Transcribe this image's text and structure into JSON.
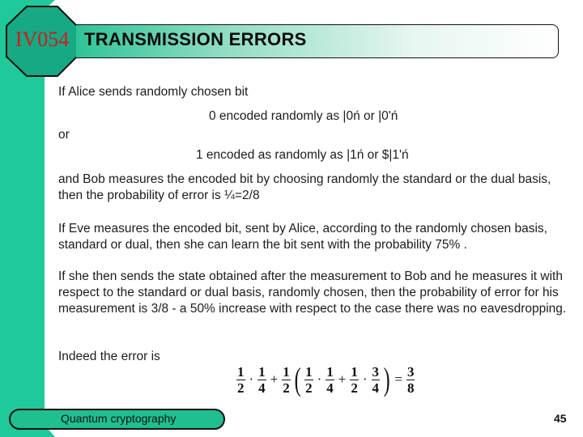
{
  "slide": {
    "course_code": "IV054",
    "title": "TRANSMISSION ERRORS",
    "colors": {
      "accent_teal": "#1fc99a",
      "octagon_fill": "#17a884",
      "course_code_red": "#c8201f"
    }
  },
  "body": {
    "p1": "If Alice sends randomly chosen bit",
    "encoding_zero": "0 encoded randomly as |0ń or |0'ń",
    "or": "or",
    "encoding_one": "1 encoded as randomly as |1ń or $|1'ń",
    "p2": "and Bob measures the encoded bit by choosing randomly the standard or the dual basis, then the probability of error is ¼=2/8",
    "p3": "If Eve measures the encoded bit, sent by Alice, according to the randomly chosen basis, standard or dual, then she can learn the bit sent with the probability 75% .",
    "p4": "If she then sends the state obtained after the measurement to Bob and he measures it with respect to the standard or dual basis, randomly chosen, then the probability of error for his measurement is 3/8 - a 50% increase with respect to the case there was no eavesdropping.",
    "p5": "Indeed the error is"
  },
  "formula": {
    "terms": [
      {
        "num": "1",
        "den": "2"
      },
      {
        "num": "1",
        "den": "4"
      },
      {
        "num": "1",
        "den": "2"
      },
      {
        "num": "1",
        "den": "2"
      },
      {
        "num": "1",
        "den": "4"
      },
      {
        "num": "1",
        "den": "2"
      },
      {
        "num": "3",
        "den": "4"
      },
      {
        "num": "3",
        "den": "8"
      }
    ],
    "dot": "·",
    "plus": "+",
    "equals": "=",
    "lparen": "(",
    "rparen": ")"
  },
  "footer": {
    "label": "Quantum cryptography",
    "page_number": "45"
  }
}
